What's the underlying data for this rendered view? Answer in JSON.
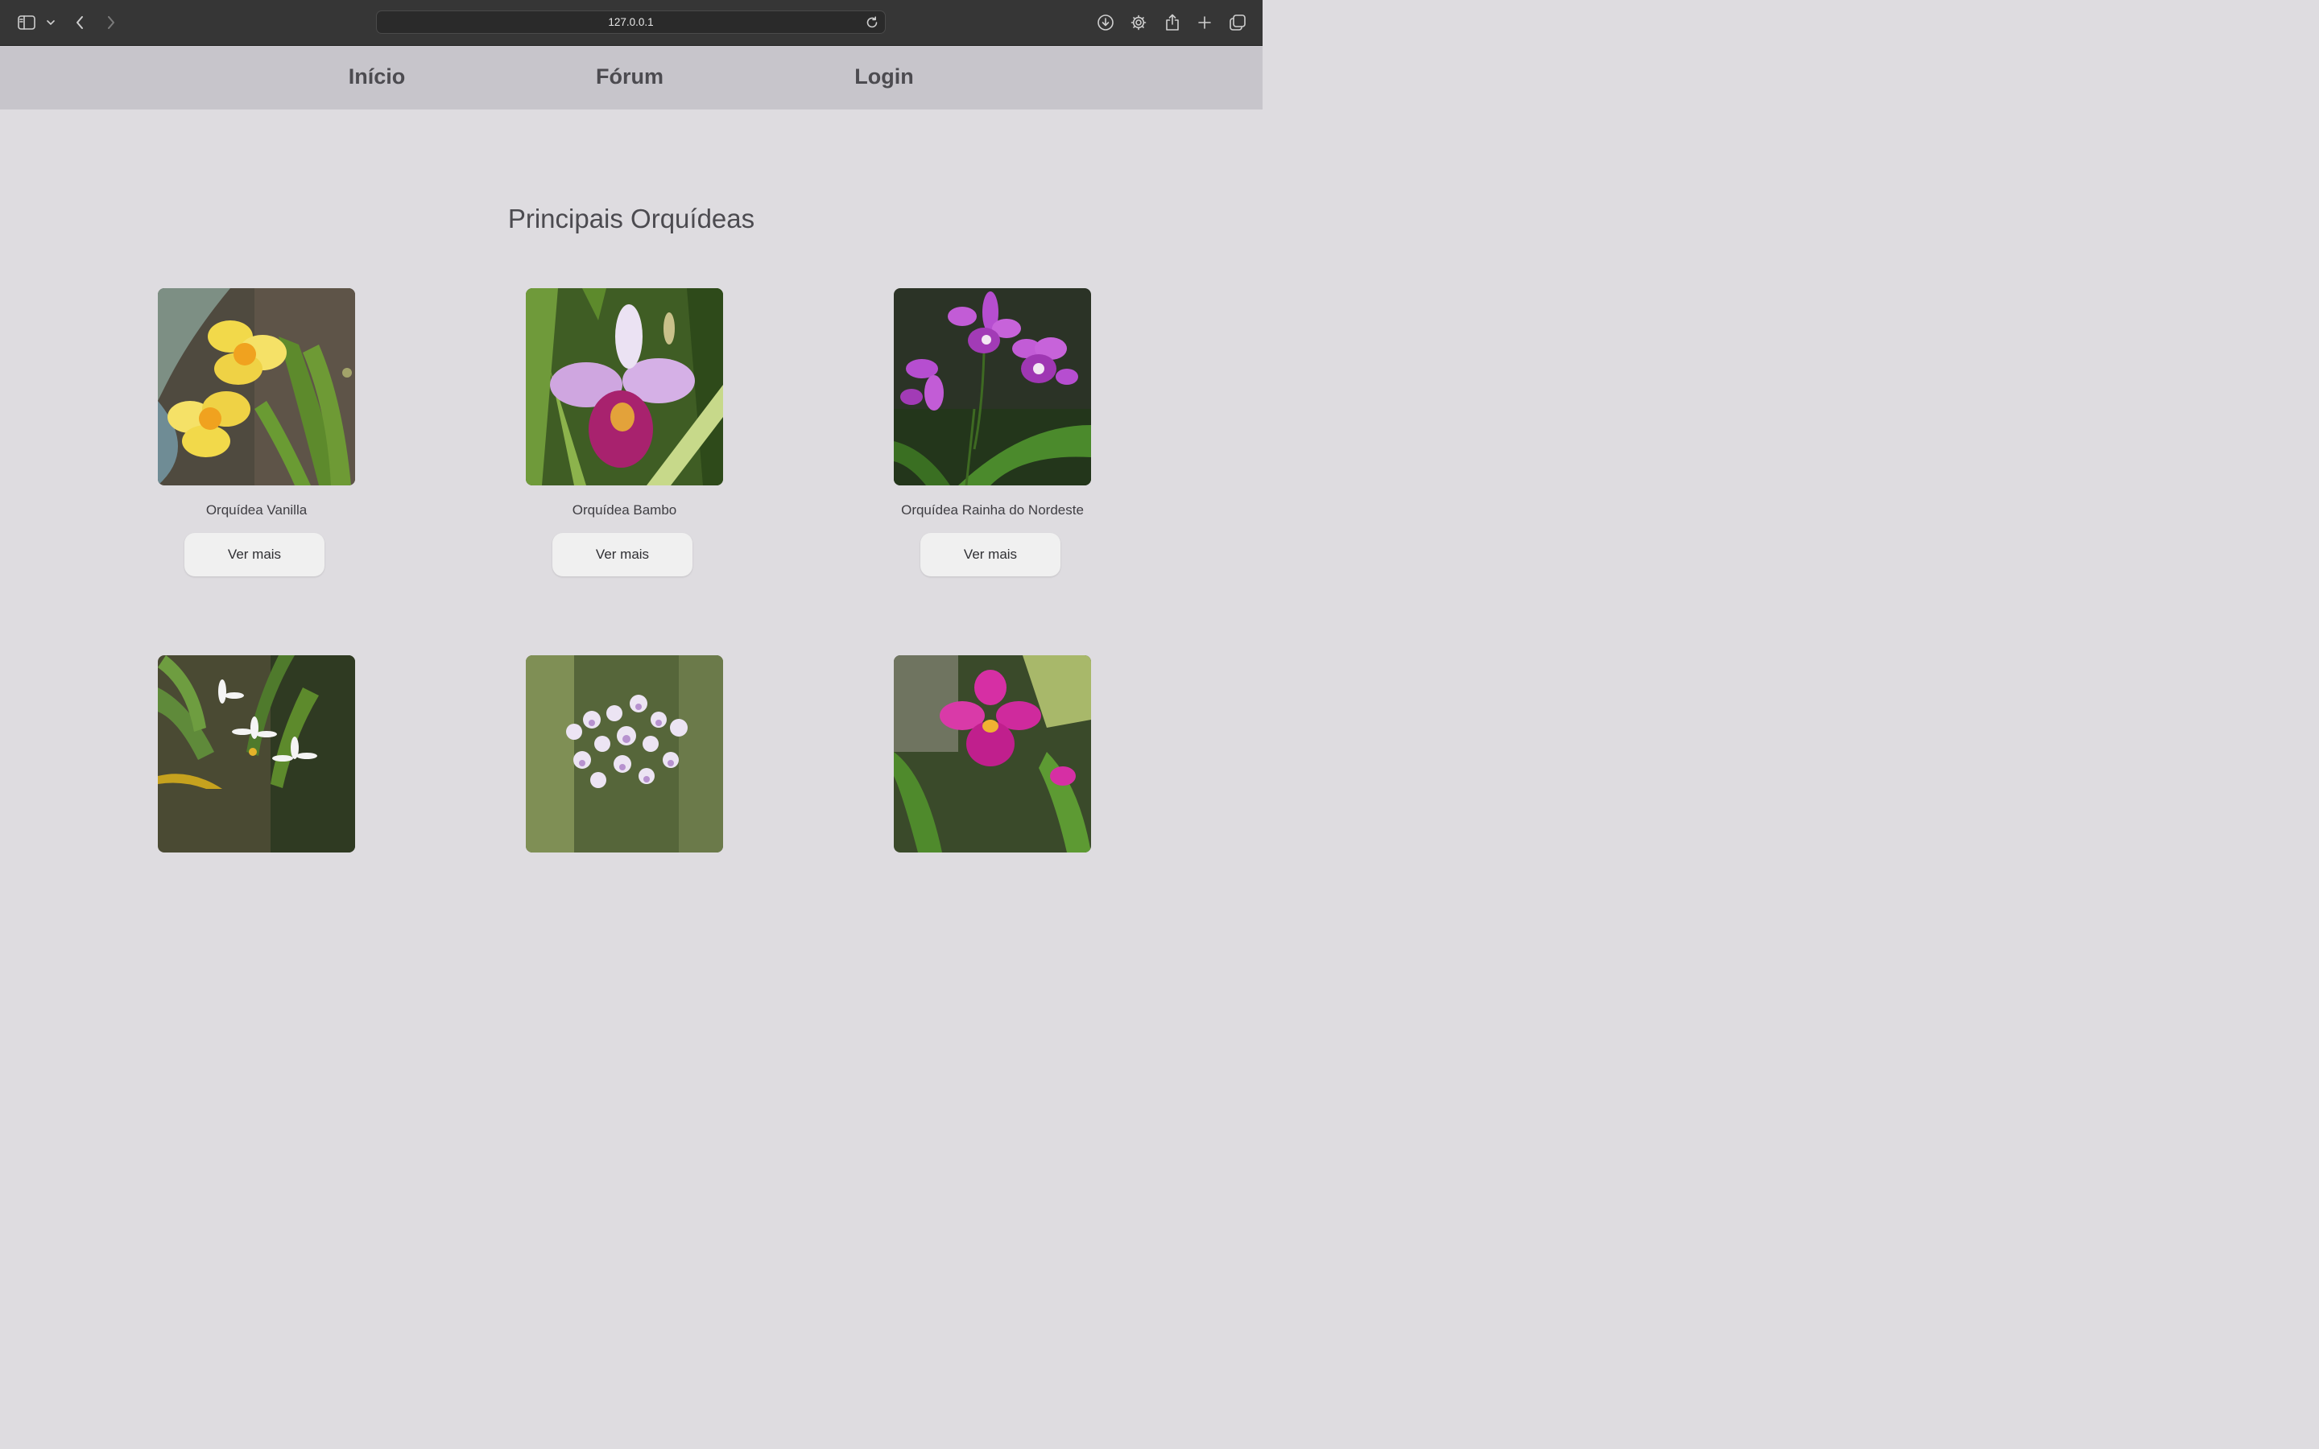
{
  "browser": {
    "url": "127.0.0.1",
    "icons": [
      "sidebar-icon",
      "chevron-down-icon",
      "back-icon",
      "forward-icon",
      "reload-icon",
      "download-icon",
      "gear-icon",
      "share-icon",
      "plus-icon",
      "tabs-icon"
    ]
  },
  "nav": {
    "items": [
      {
        "label": "Início"
      },
      {
        "label": "Fórum"
      },
      {
        "label": "Login"
      }
    ]
  },
  "main": {
    "title": "Principais Orquídeas",
    "cards": [
      {
        "name": "Orquídea Vanilla",
        "button": "Ver mais",
        "flower_color": "#f2d94a"
      },
      {
        "name": "Orquídea Bambo",
        "button": "Ver mais",
        "flower_color": "#cfa6e0"
      },
      {
        "name": "Orquídea Rainha do Nordeste",
        "button": "Ver mais",
        "flower_color": "#c25cd6"
      },
      {
        "name": "",
        "button": "",
        "flower_color": "#f4f4f4"
      },
      {
        "name": "",
        "button": "",
        "flower_color": "#ddd0ee"
      },
      {
        "name": "",
        "button": "",
        "flower_color": "#d62fa4"
      }
    ]
  },
  "colors": {
    "page_bg": "#dedce0",
    "nav_bg": "#c7c5cb",
    "text": "#4c4b50",
    "button_bg": "#f0f0f0"
  }
}
